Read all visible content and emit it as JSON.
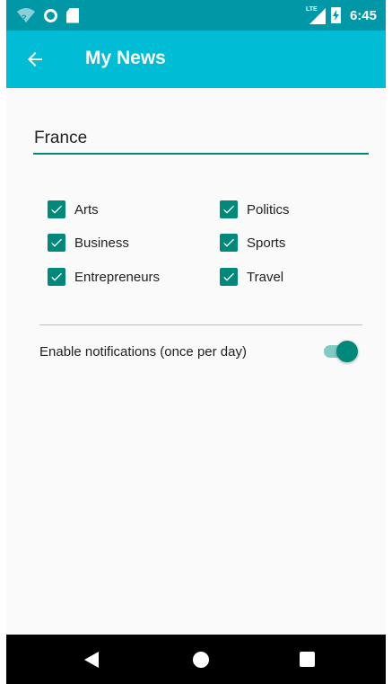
{
  "status_bar": {
    "network_label": "LTE",
    "time": "6:45"
  },
  "app_bar": {
    "title": "My News"
  },
  "country": {
    "value": "France"
  },
  "topics": [
    {
      "label": "Arts",
      "checked": true
    },
    {
      "label": "Business",
      "checked": true
    },
    {
      "label": "Entrepreneurs",
      "checked": true
    },
    {
      "label": "Politics",
      "checked": true
    },
    {
      "label": "Sports",
      "checked": true
    },
    {
      "label": "Travel",
      "checked": true
    }
  ],
  "notifications": {
    "label": "Enable notifications (once per day)",
    "enabled": true
  },
  "colors": {
    "status_bar": "#0097a7",
    "app_bar": "#00bcd4",
    "accent": "#00897b"
  }
}
